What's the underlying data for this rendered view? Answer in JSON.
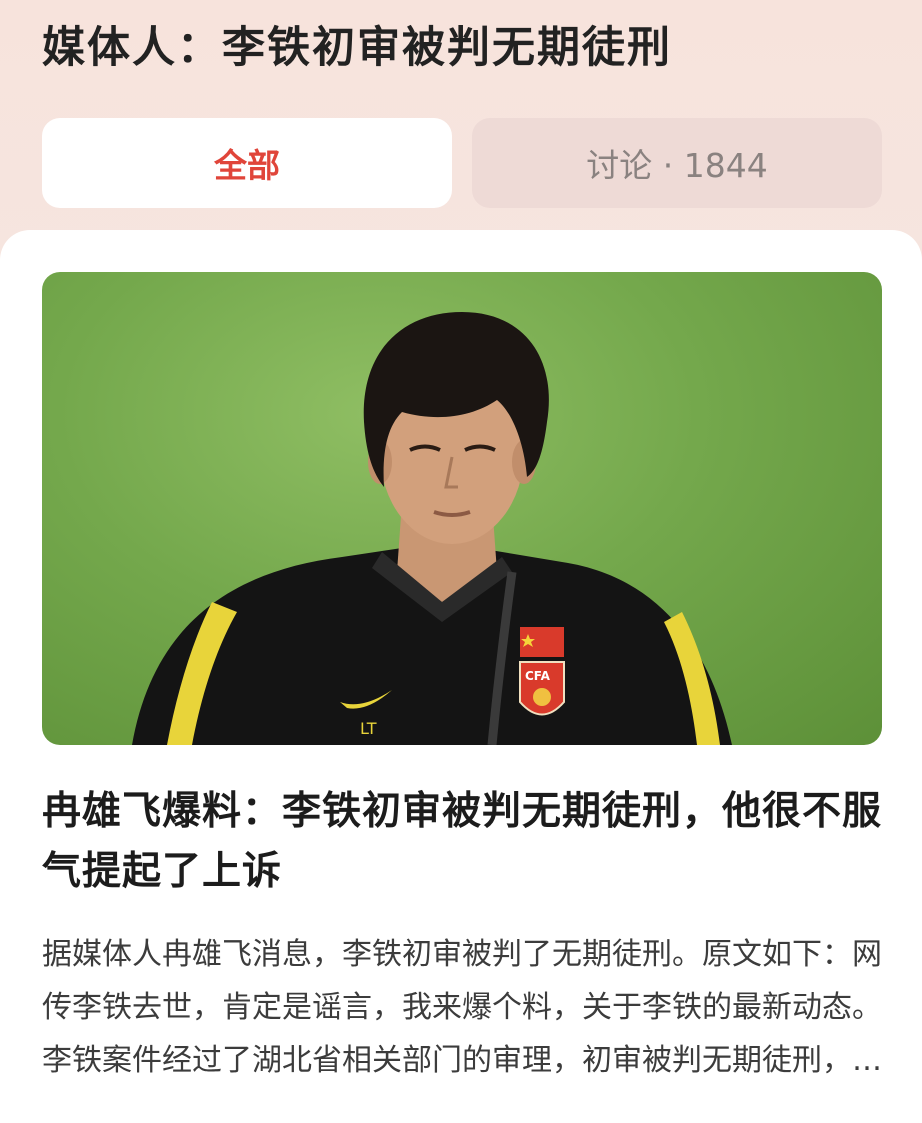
{
  "topic": {
    "title": "媒体人：李铁初审被判无期徒刑"
  },
  "tabs": [
    {
      "label": "全部",
      "active": true
    },
    {
      "label": "讨论 · 1844",
      "active": false
    }
  ],
  "article": {
    "image_alt": "coach-photo",
    "jersey_text": "LT",
    "badge_text": "CFA",
    "headline": "冉雄飞爆料：李铁初审被判无期徒刑，他很不服气提起了上诉",
    "summary": "据媒体人冉雄飞消息，李铁初审被判了无期徒刑。原文如下：网传李铁去世，肯定是谣言，我来爆个料，关于李铁的最新动态。李铁案件经过了湖北省相关部门的审理，初审被判无期徒刑，他很不服气，提起了上诉。"
  },
  "colors": {
    "accent": "#e0453a",
    "tab_inactive_bg": "#eedad6"
  }
}
